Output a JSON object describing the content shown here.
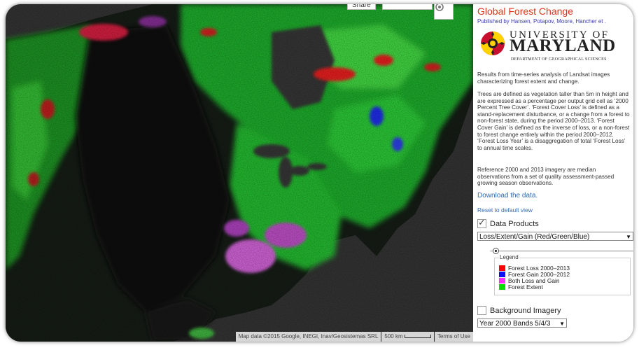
{
  "map": {
    "share_label": "Share",
    "attribution": "Map data ©2015 Google, INEGI, Inav/Geosistemas SRL",
    "scale_label": "500 km",
    "terms_label": "Terms of Use",
    "icons": {
      "geolocate": "location-icon"
    }
  },
  "panel": {
    "title": "Global Forest Change",
    "authors": "Published by Hansen, Potapov, Moore, Hancher et .",
    "logo": {
      "line1": "UNIVERSITY OF",
      "line2": "MARYLAND",
      "line3": "DEPARTMENT OF GEOGRAPHICAL SCIENCES"
    },
    "intro": "Results from time-series analysis of Landsat images characterizing forest extent and change.",
    "definitions": "Trees are defined as vegetation taller than 5m in height and are expressed as a percentage per output grid cell as ‘2000 Percent Tree Cover’. ‘Forest Cover Loss’ is defined as a stand-replacement disturbance, or a change from a forest to non-forest state, during the period 2000–2013. ‘Forest Cover Gain’ is defined as the inverse of loss, or a non-forest to forest change entirely within the period 2000–2012. ‘Forest Loss Year’ is a disaggregation of total ‘Forest Loss’ to annual time scales.",
    "reference": "Reference 2000 and 2013 imagery are median observations from a set of quality assessment-passed growing season observations.",
    "download_label": "Download the data.",
    "reset_label": "Reset to default view",
    "data_products": {
      "label": "Data Products",
      "checked": true,
      "selected": "Loss/Extent/Gain (Red/Green/Blue)"
    },
    "opacity": 0.02,
    "legend": {
      "title": "Legend",
      "items": [
        {
          "label": "Forest Loss 2000–2013",
          "color": "#ff0000"
        },
        {
          "label": "Forest Gain 2000–2012",
          "color": "#1010ff"
        },
        {
          "label": "Both Loss and Gain",
          "color": "#ff30ff"
        },
        {
          "label": "Forest Extent",
          "color": "#00dd00"
        }
      ]
    },
    "background_imagery": {
      "label": "Background Imagery",
      "checked": false,
      "selected": "Year 2000 Bands 5/4/3"
    }
  }
}
